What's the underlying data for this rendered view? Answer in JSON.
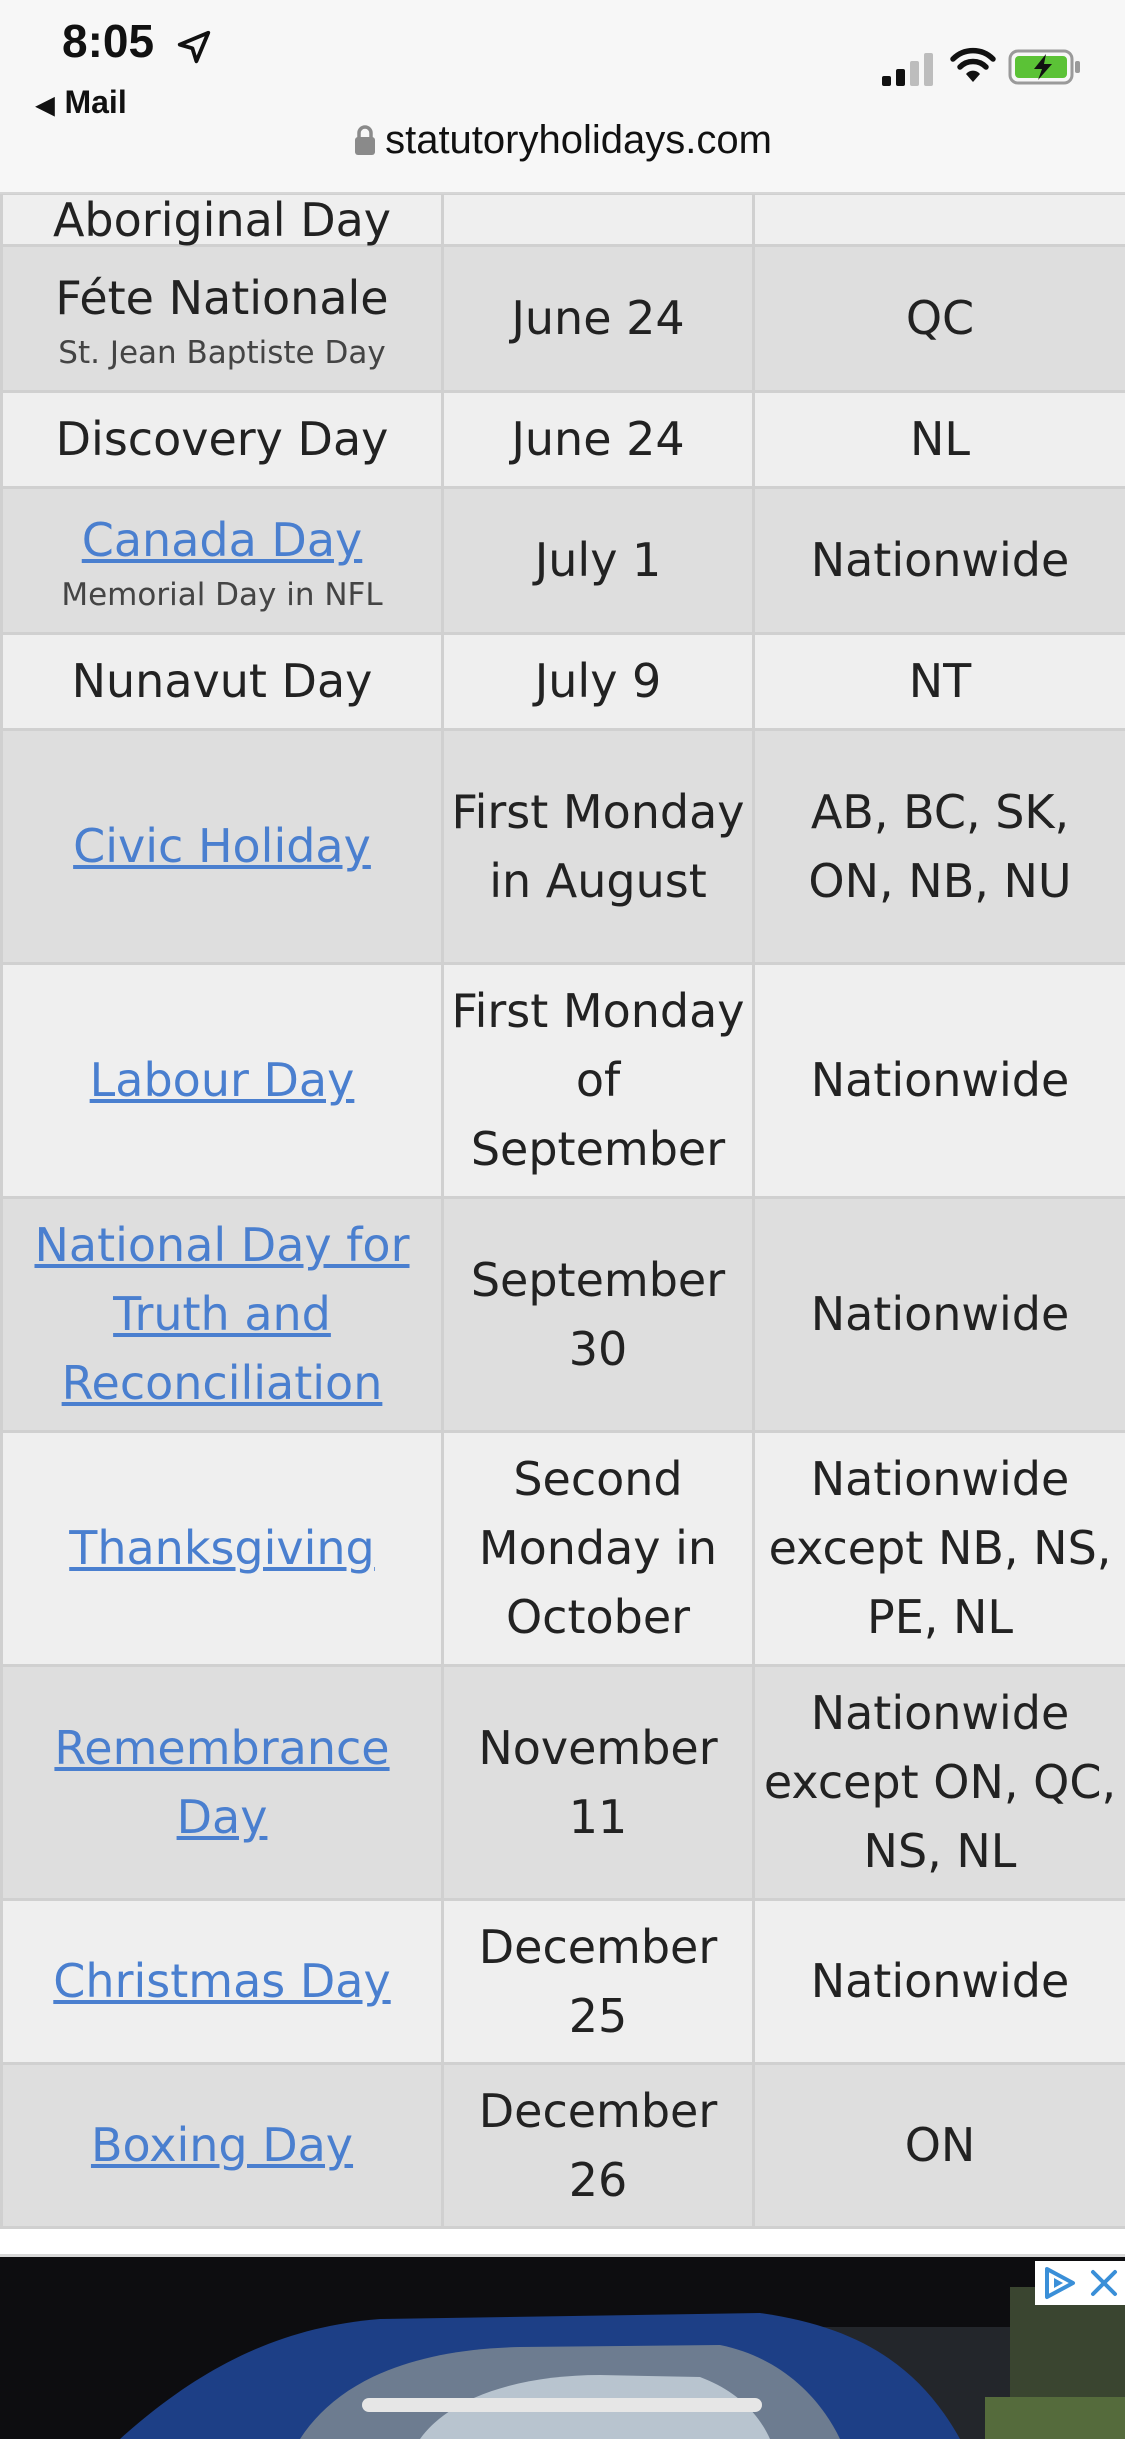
{
  "status_bar": {
    "time": "8:05",
    "back_app": "Mail"
  },
  "address_bar": {
    "url": "statutoryholidays.com"
  },
  "holidays": [
    {
      "name": "Aboriginal Day",
      "subtitle": "",
      "is_link": false,
      "date": "",
      "region": ""
    },
    {
      "name": "Féte Nationale",
      "subtitle": "St. Jean Baptiste Day",
      "is_link": false,
      "date": "June 24",
      "region": "QC"
    },
    {
      "name": "Discovery Day",
      "subtitle": "",
      "is_link": false,
      "date": "June 24",
      "region": "NL"
    },
    {
      "name": "Canada Day",
      "subtitle": "Memorial Day in NFL",
      "is_link": true,
      "date": "July 1",
      "region": "Nationwide"
    },
    {
      "name": "Nunavut Day",
      "subtitle": "",
      "is_link": false,
      "date": "July 9",
      "region": "NT"
    },
    {
      "name": "Civic Holiday",
      "subtitle": "",
      "is_link": true,
      "date": "First Monday in August",
      "region": "AB, BC, SK, ON, NB, NU"
    },
    {
      "name": "Labour Day",
      "subtitle": "",
      "is_link": true,
      "date": "First Monday of September",
      "region": "Nationwide"
    },
    {
      "name": "National Day for Truth and Reconciliation",
      "subtitle": "",
      "is_link": true,
      "date": "September 30",
      "region": "Nationwide"
    },
    {
      "name": "Thanksgiving",
      "subtitle": "",
      "is_link": true,
      "date": "Second Monday in October",
      "region": "Nationwide except NB, NS, PE, NL"
    },
    {
      "name": "Remembrance Day",
      "subtitle": "",
      "is_link": true,
      "date": "November 11",
      "region": "Nationwide except ON, QC, NS, NL"
    },
    {
      "name": "Christmas Day",
      "subtitle": "",
      "is_link": true,
      "date": "December 25",
      "region": "Nationwide"
    },
    {
      "name": "Boxing Day",
      "subtitle": "",
      "is_link": true,
      "date": "December 26",
      "region": "ON"
    }
  ],
  "colors": {
    "link": "#4a7fcf",
    "row_light": "#efefef",
    "row_dark": "#dedede",
    "battery_fill": "#5bc236"
  }
}
